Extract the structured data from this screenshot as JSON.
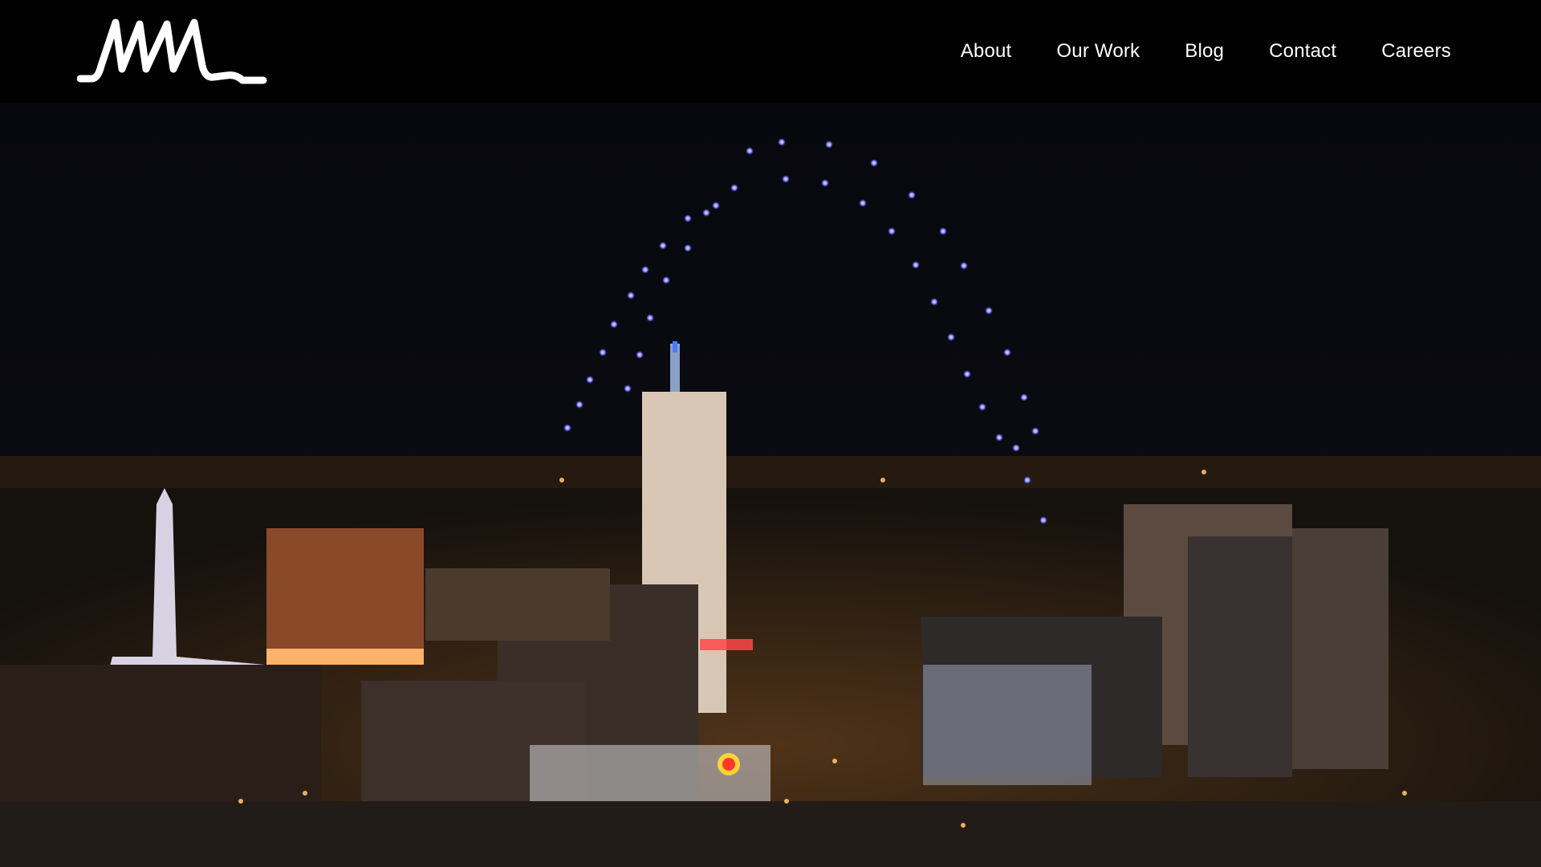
{
  "brand": {
    "logo_text": "MMM",
    "logo_icon": "wave-signature-logo"
  },
  "nav": {
    "items": [
      {
        "label": "About"
      },
      {
        "label": "Our Work"
      },
      {
        "label": "Blog"
      },
      {
        "label": "Contact"
      },
      {
        "label": "Careers"
      }
    ]
  },
  "hero": {
    "image_description": "",
    "colors": {
      "sky": "#05060b",
      "drone": "#8b8cff",
      "city_glow": "#ff9b3a"
    }
  }
}
